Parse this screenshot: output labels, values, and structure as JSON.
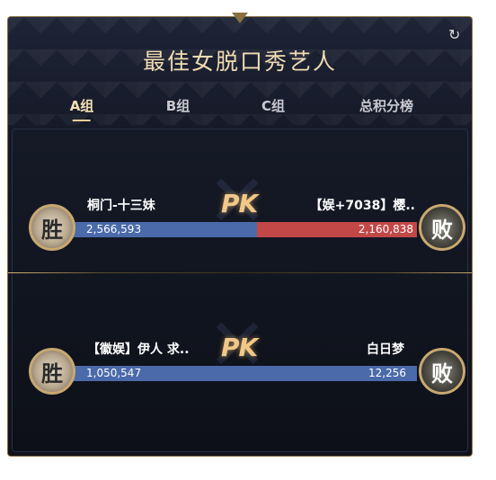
{
  "title": "最佳女脱口秀艺人",
  "tabs": [
    {
      "label": "A组",
      "active": true
    },
    {
      "label": "B组",
      "active": false
    },
    {
      "label": "C组",
      "active": false
    },
    {
      "label": "总积分榜",
      "active": false
    }
  ],
  "matches": [
    {
      "left": {
        "name": "桐门-十三妹",
        "score": "2,566,593",
        "result": "胜"
      },
      "right": {
        "name": "【娱+7038】樱..",
        "score": "2,160,838",
        "result": "败"
      },
      "pk_label": "PK",
      "left_share": 0.543
    },
    {
      "left": {
        "name": "【徽娱】伊人 求..",
        "score": "1,050,547",
        "result": "胜"
      },
      "right": {
        "name": "白日梦",
        "score": "12,256",
        "result": "败"
      },
      "pk_label": "PK",
      "left_share": 1.0
    }
  ],
  "colors": {
    "accent_gold": "#f0dcb2",
    "bar_blue": "#4a6aaa",
    "bar_red": "#c24848"
  }
}
